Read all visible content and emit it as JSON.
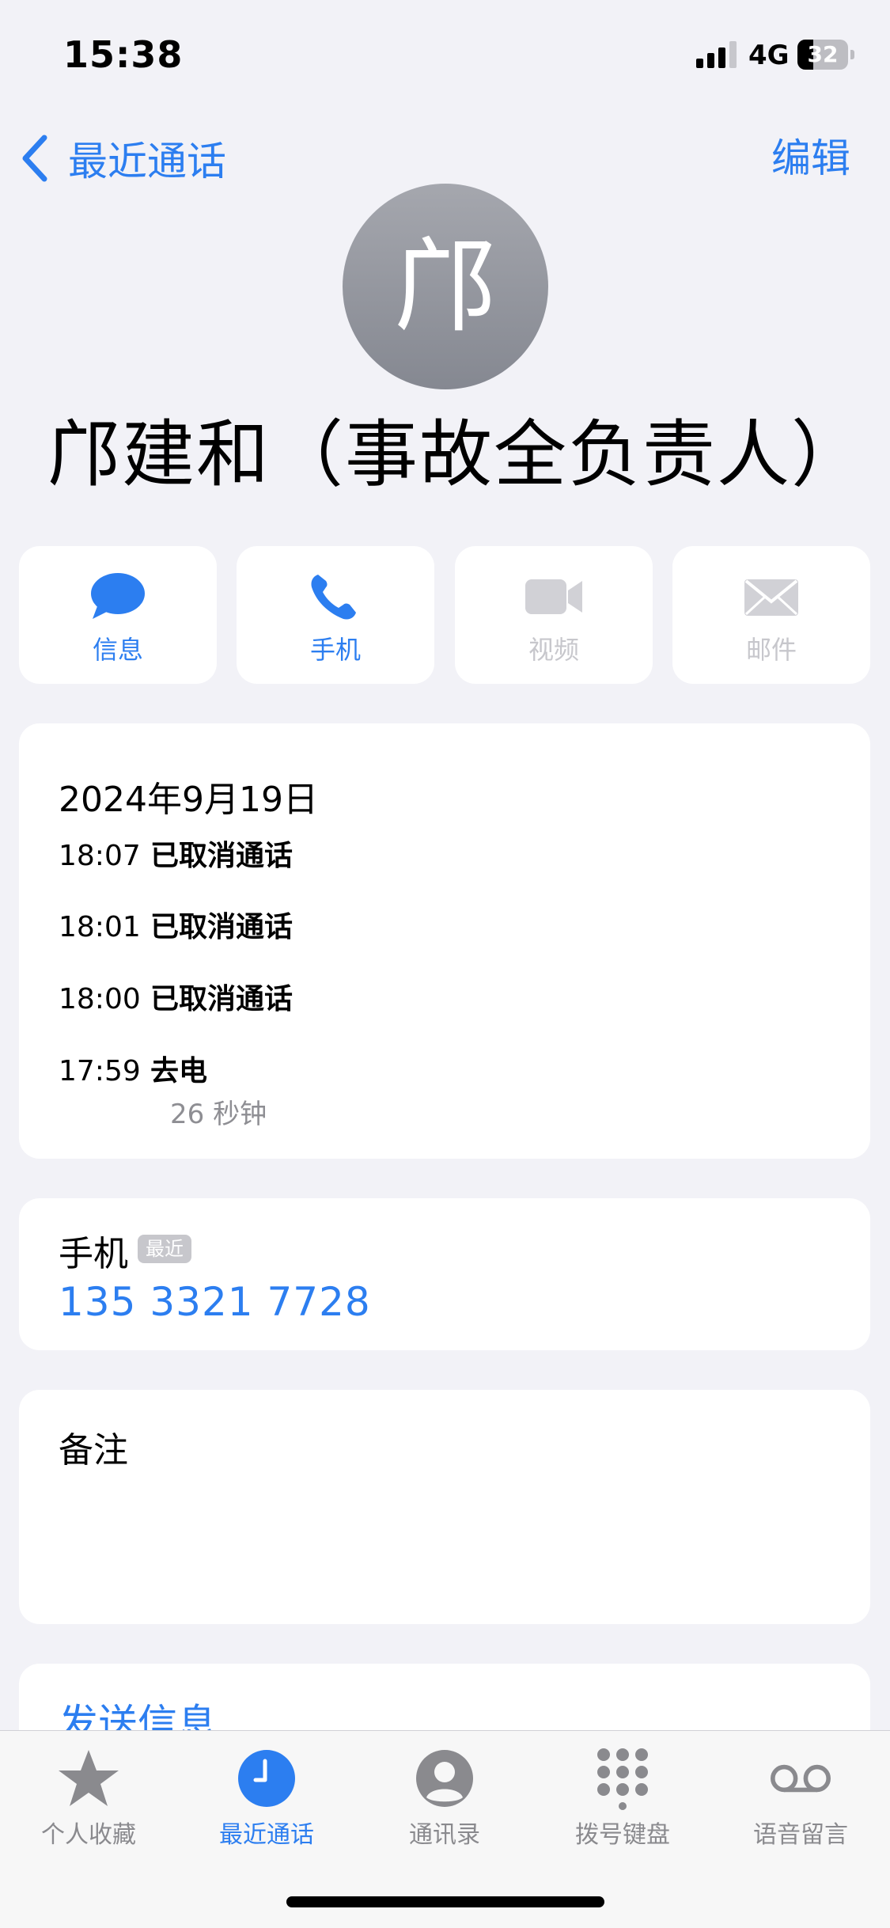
{
  "status_bar": {
    "time": "15:38",
    "network": "4G",
    "battery_level": "32",
    "battery_fraction": 0.32,
    "signal_bars": 3
  },
  "nav": {
    "back_label": "最近通话",
    "edit_label": "编辑",
    "accent_color": "#2c7ef0"
  },
  "contact": {
    "avatar_initial": "邝",
    "name": "邝建和（事故全负责人）"
  },
  "actions": [
    {
      "label": "信息",
      "icon": "message-bubble-icon",
      "enabled": true
    },
    {
      "label": "手机",
      "icon": "phone-icon",
      "enabled": true
    },
    {
      "label": "视频",
      "icon": "video-camera-icon",
      "enabled": false
    },
    {
      "label": "邮件",
      "icon": "mail-icon",
      "enabled": false
    }
  ],
  "call_history": {
    "date": "2024年9月19日",
    "calls": [
      {
        "time": "18:07",
        "status": "已取消通话",
        "duration": ""
      },
      {
        "time": "18:01",
        "status": "已取消通话",
        "duration": ""
      },
      {
        "time": "18:00",
        "status": "已取消通话",
        "duration": ""
      },
      {
        "time": "17:59",
        "status": "去电",
        "duration": "26 秒钟"
      }
    ]
  },
  "phone": {
    "label": "手机",
    "badge": "最近",
    "number": "135 3321 7728"
  },
  "notes": {
    "label": "备注"
  },
  "send_message": {
    "label": "发送信息"
  },
  "tab_bar": {
    "tabs": [
      {
        "label": "个人收藏",
        "icon": "star-icon",
        "active": false
      },
      {
        "label": "最近通话",
        "icon": "clock-icon",
        "active": true
      },
      {
        "label": "通讯录",
        "icon": "person-circle-icon",
        "active": false
      },
      {
        "label": "拨号键盘",
        "icon": "keypad-icon",
        "active": false
      },
      {
        "label": "语音留言",
        "icon": "voicemail-icon",
        "active": false
      }
    ]
  }
}
